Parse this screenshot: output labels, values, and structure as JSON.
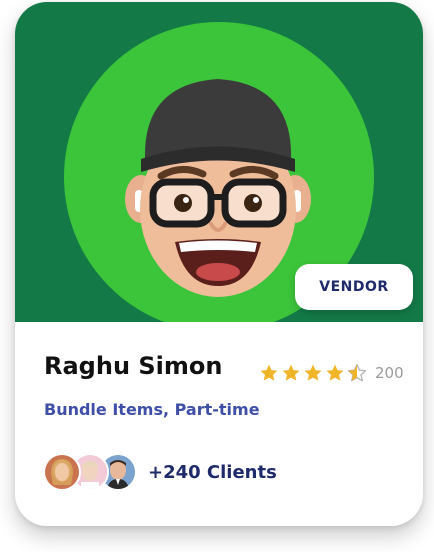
{
  "profile": {
    "name": "Raghu Simon",
    "badge": "VENDOR",
    "subtitle": "Bundle Items, Part-time",
    "rating": {
      "value": 4.5,
      "max": 5,
      "count": "200"
    },
    "clients_label": "+240 Clients",
    "client_avatars": [
      "client-avatar-1",
      "client-avatar-2",
      "client-avatar-3"
    ]
  },
  "colors": {
    "hero_background": "#137a47",
    "hero_circle": "#3cc43a",
    "star": "#f0b429",
    "accent_text": "#3f4fa8",
    "badge_text": "#1f2a6b"
  }
}
